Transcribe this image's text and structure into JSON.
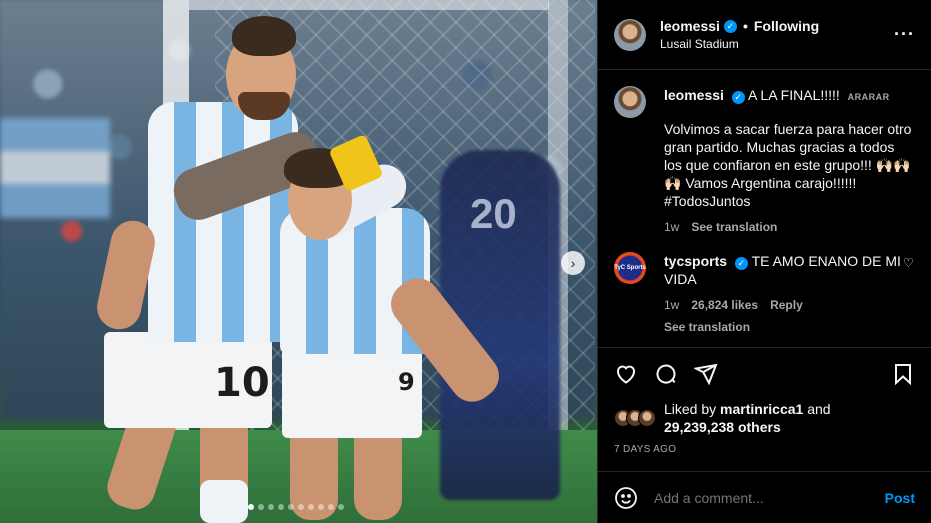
{
  "header": {
    "username": "leomessi",
    "follow_status": "Following",
    "separator": "•",
    "location": "Lusail Stadium",
    "more_icon": "more-horizontal-icon"
  },
  "caption": {
    "username": "leomessi",
    "title": "A LA FINAL!!!!!",
    "tag": "ARARAR",
    "text": "Volvimos a sacar fuerza para hacer otro gran partido. Muchas gracias a todos los que confiaron en este grupo!!! 🙌🏻🙌🏻🙌🏻 Vamos Argentina carajo!!!!!! #TodosJuntos",
    "age": "1w",
    "see_translation": "See translation"
  },
  "comment": {
    "username": "tycsports",
    "avatar_text": "TyC Sports",
    "text": "TE AMO ENANO DE MI VIDA",
    "age": "1w",
    "likes": "26,824 likes",
    "reply": "Reply",
    "see_translation": "See translation"
  },
  "photo": {
    "jersey_number_front": "10",
    "jersey_number_back": "9",
    "bg_number": "20",
    "slide_count": 10,
    "active_slide": 0
  },
  "likes": {
    "liked_by_prefix": "Liked by",
    "liked_by_user": "martinricca1",
    "and": "and",
    "others": "29,239,238 others"
  },
  "post_age": "7 DAYS AGO",
  "add_comment": {
    "placeholder": "Add a comment...",
    "post_label": "Post"
  },
  "colors": {
    "background": "#000000",
    "accent": "#0095f6",
    "muted": "#a8a8a8"
  }
}
